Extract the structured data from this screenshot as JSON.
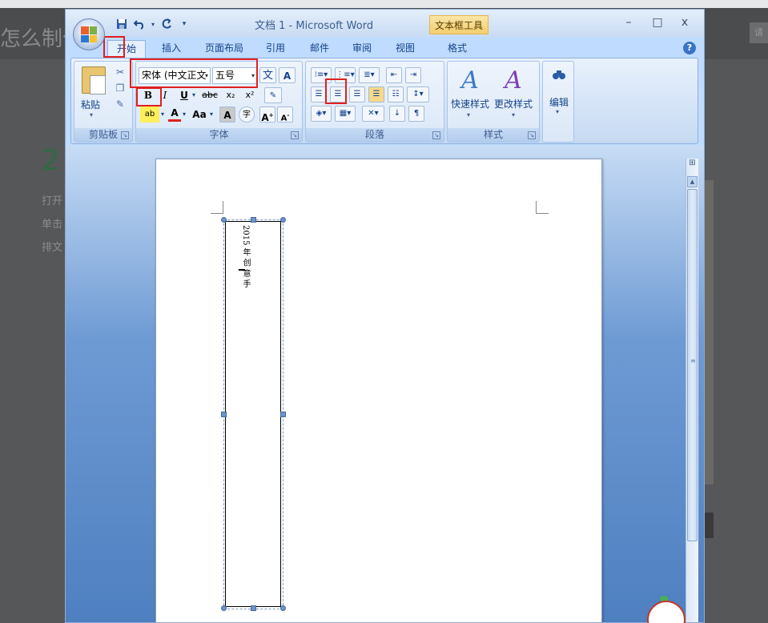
{
  "background": {
    "title_fragment": "怎么制作",
    "right_button": "请",
    "step_number": "2",
    "lines": [
      "打开",
      "单击",
      "排文"
    ]
  },
  "window": {
    "title": "文档 1 - Microsoft Word",
    "contextual_tab_title": "文本框工具",
    "controls": {
      "minimize": "–",
      "maximize": "□",
      "close": "x"
    }
  },
  "quick_access": [
    {
      "icon": "save-icon",
      "glyph": "▪"
    },
    {
      "icon": "undo-icon",
      "glyph": "↶"
    },
    {
      "icon": "redo-icon",
      "glyph": "↷"
    },
    {
      "icon": "customize-icon",
      "glyph": "▾"
    }
  ],
  "tabs": {
    "home": "开始",
    "insert": "插入",
    "page_layout": "页面布局",
    "references": "引用",
    "mailings": "邮件",
    "review": "审阅",
    "view": "视图",
    "format": "格式"
  },
  "ribbon": {
    "clipboard": {
      "label": "剪贴板",
      "paste": "粘贴"
    },
    "font": {
      "label": "字体",
      "font_name": "宋体 (中文正文",
      "font_size": "五号",
      "bold": "B",
      "italic": "I",
      "underline": "U",
      "strikethrough": "abc",
      "subscript": "x₂",
      "superscript": "x²",
      "font_color": "A",
      "change_case": "Aa",
      "char_shading": "A",
      "enclose": "字",
      "grow": "A",
      "shrink": "A",
      "phonetic": "文",
      "char_border": "A"
    },
    "paragraph": {
      "label": "段落"
    },
    "styles": {
      "label": "样式",
      "quick_styles": "快速样式",
      "change_styles": "更改样式"
    },
    "editing": {
      "label": "编辑"
    }
  },
  "document": {
    "textbox_text": "2015 年 创 意 手"
  },
  "colors": {
    "highlight_box": "#e02020",
    "ribbon_bg": "#d5e4f7",
    "doc_bg": "#6f9bd4"
  }
}
